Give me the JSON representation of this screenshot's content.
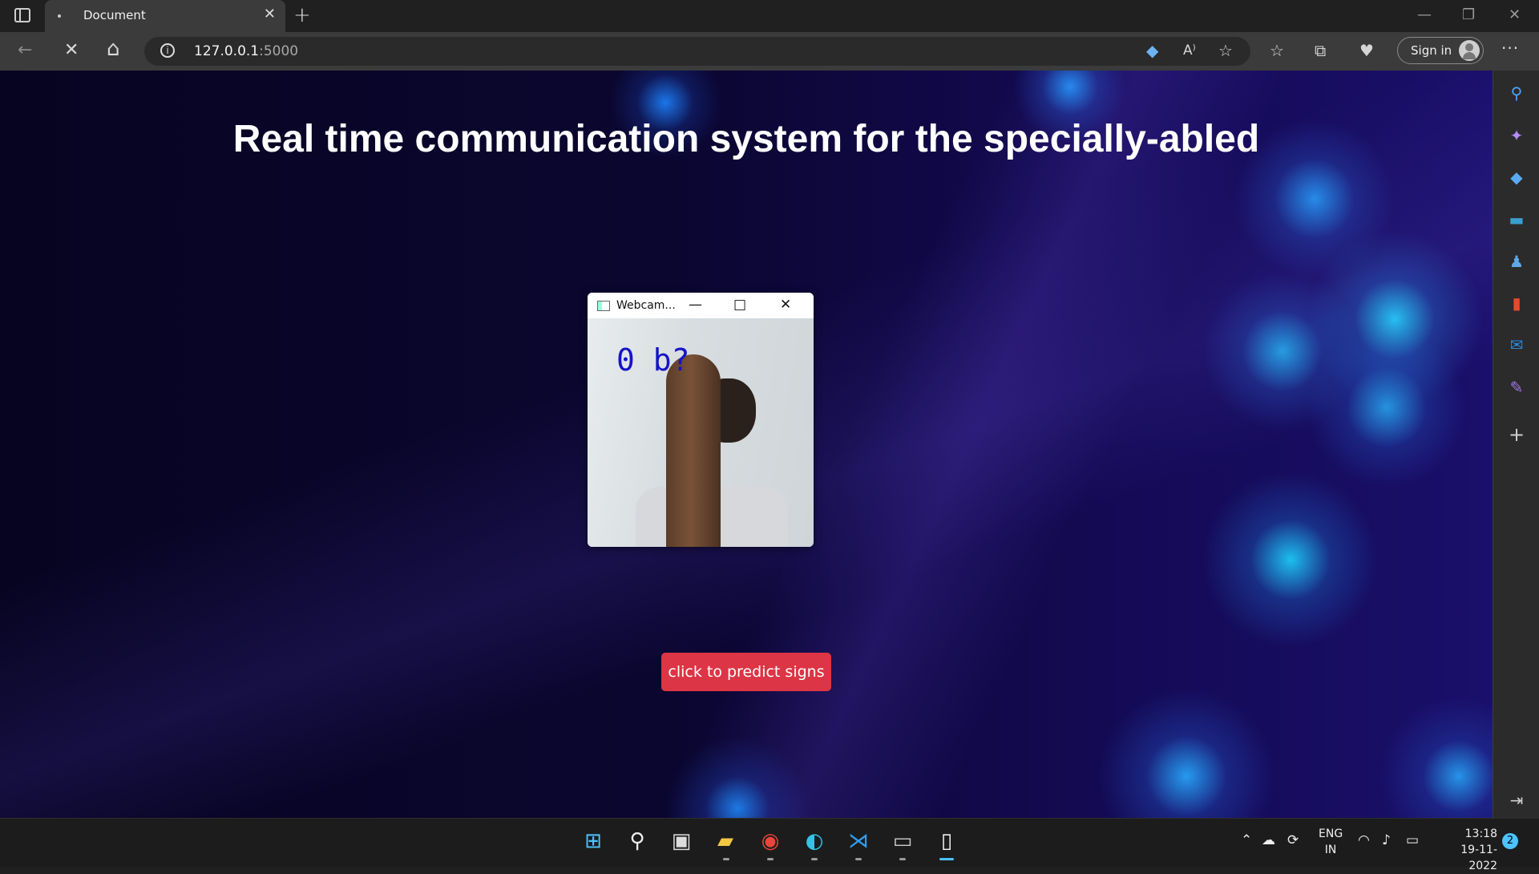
{
  "browser": {
    "tab_title": "Document",
    "new_tab_symbol": "+",
    "url_host": "127.0.0.1",
    "url_port": ":5000",
    "sign_in_label": "Sign in",
    "more_symbol": "···",
    "nav": {
      "back_icon": "←",
      "stop_icon": "✕",
      "home_icon": "⌂"
    },
    "window_controls": {
      "minimize": "—",
      "restore": "❐",
      "close": "✕"
    },
    "toolbar_icons": [
      "coupon-icon",
      "read-aloud-icon",
      "add-favorite-icon",
      "favorites-icon",
      "collections-icon",
      "browser-essentials-icon"
    ]
  },
  "page": {
    "headline": "Real time communication system for the specially-abled",
    "predict_button_label": "click to predict signs",
    "accent_color": "#dc3545"
  },
  "webcam_window": {
    "title": "Webcam...",
    "prediction_overlay": "0 b?",
    "controls": {
      "minimize": "—",
      "maximize": "□",
      "close": "✕"
    }
  },
  "sidebar_icons": [
    "search-icon",
    "copilot-icon",
    "shopping-icon",
    "tools-icon",
    "games-icon",
    "office-icon",
    "outlook-icon",
    "drop-icon",
    "add-icon",
    "hide-sidebar-icon"
  ],
  "taskbar": {
    "apps": [
      "start-icon",
      "search-icon",
      "task-view-icon",
      "file-explorer-icon",
      "chrome-icon",
      "edge-icon",
      "vscode-icon",
      "terminal-icon",
      "notepad-icon"
    ],
    "language_line1": "ENG",
    "language_line2": "IN",
    "time": "13:18",
    "date": "19-11-2022",
    "notification_count": "2"
  }
}
